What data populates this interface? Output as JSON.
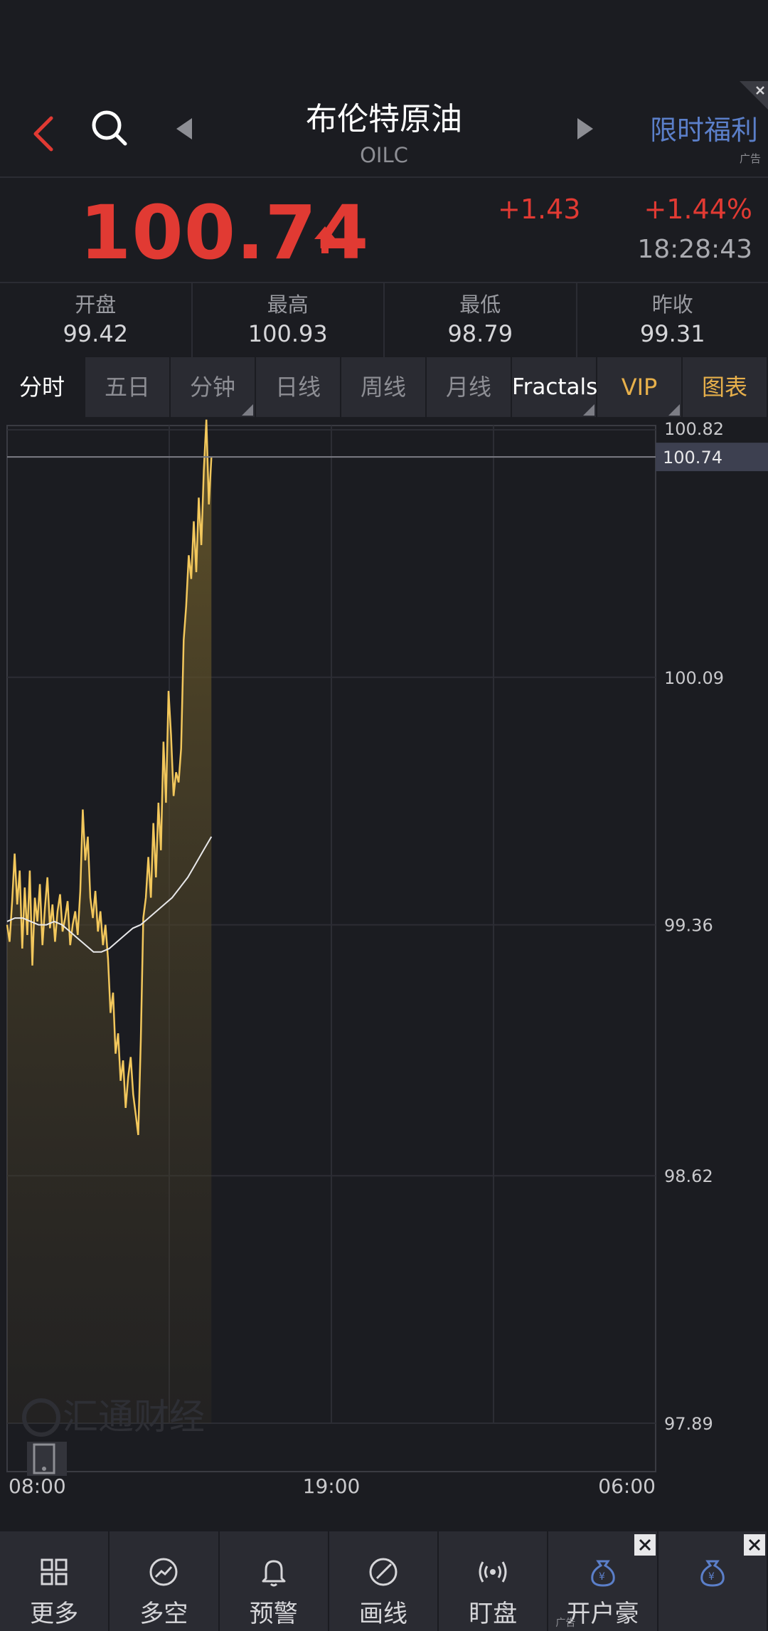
{
  "header": {
    "title": "布伦特原油",
    "code": "OILC",
    "promo_label": "限时福利",
    "promo_ad_tag": "广告"
  },
  "quote": {
    "price": "100.74",
    "change": "+1.43",
    "change_pct": "+1.44%",
    "time": "18:28:43",
    "up_color": "#e13a33"
  },
  "stats": [
    {
      "label": "开盘",
      "value": "99.42"
    },
    {
      "label": "最高",
      "value": "100.93"
    },
    {
      "label": "最低",
      "value": "98.79"
    },
    {
      "label": "昨收",
      "value": "99.31"
    }
  ],
  "tabs": [
    {
      "label": "分时",
      "active": true
    },
    {
      "label": "五日"
    },
    {
      "label": "分钟",
      "dropdown": true
    },
    {
      "label": "日线"
    },
    {
      "label": "周线"
    },
    {
      "label": "月线"
    },
    {
      "label": "Fractals",
      "dropdown": true
    },
    {
      "label": "VIP",
      "dropdown": true
    },
    {
      "label": "图表"
    }
  ],
  "chart_data": {
    "type": "area",
    "y_ticks": [
      "100.82",
      "100.09",
      "99.36",
      "98.62",
      "97.89"
    ],
    "ylim": [
      97.89,
      100.82
    ],
    "x_ticks": [
      "08:00",
      "19:00",
      "06:00"
    ],
    "last_price_label": "100.74",
    "last_price": 100.74,
    "series": [
      {
        "kind": "price",
        "color": "#f2c75c",
        "values": [
          99.36,
          99.31,
          99.43,
          99.57,
          99.42,
          99.52,
          99.29,
          99.47,
          99.33,
          99.52,
          99.24,
          99.44,
          99.37,
          99.48,
          99.3,
          99.41,
          99.5,
          99.35,
          99.42,
          99.31,
          99.4,
          99.45,
          99.34,
          99.38,
          99.43,
          99.3,
          99.36,
          99.4,
          99.33,
          99.46,
          99.7,
          99.55,
          99.62,
          99.44,
          99.38,
          99.46,
          99.34,
          99.4,
          99.3,
          99.36,
          99.26,
          99.1,
          99.16,
          98.98,
          99.04,
          98.9,
          98.96,
          98.82,
          98.91,
          98.97,
          98.86,
          98.8,
          98.74,
          99.02,
          99.38,
          99.44,
          99.56,
          99.44,
          99.66,
          99.5,
          99.72,
          99.58,
          99.9,
          99.72,
          100.05,
          99.92,
          99.74,
          99.81,
          99.78,
          99.88,
          100.2,
          100.3,
          100.45,
          100.38,
          100.55,
          100.4,
          100.62,
          100.48,
          100.7,
          100.85,
          100.6,
          100.74
        ]
      },
      {
        "kind": "average",
        "color": "#e8e8ea",
        "values": [
          99.37,
          99.38,
          99.38,
          99.37,
          99.36,
          99.36,
          99.37,
          99.36,
          99.34,
          99.32,
          99.3,
          99.28,
          99.28,
          99.29,
          99.31,
          99.33,
          99.35,
          99.36,
          99.38,
          99.4,
          99.42,
          99.44,
          99.47,
          99.5,
          99.54,
          99.58,
          99.62
        ]
      }
    ]
  },
  "watermark": "汇通财经",
  "bottom_nav": [
    {
      "label": "更多",
      "icon": "grid-icon"
    },
    {
      "label": "多空",
      "icon": "trend-icon"
    },
    {
      "label": "预警",
      "icon": "bell-icon"
    },
    {
      "label": "画线",
      "icon": "draw-icon"
    },
    {
      "label": "盯盘",
      "icon": "broadcast-icon"
    },
    {
      "label": "开户豪",
      "icon": "moneybag-icon",
      "ad": true,
      "ad_tag": "广告"
    },
    {
      "label": "",
      "icon": "moneybag-icon",
      "ad": true
    }
  ]
}
